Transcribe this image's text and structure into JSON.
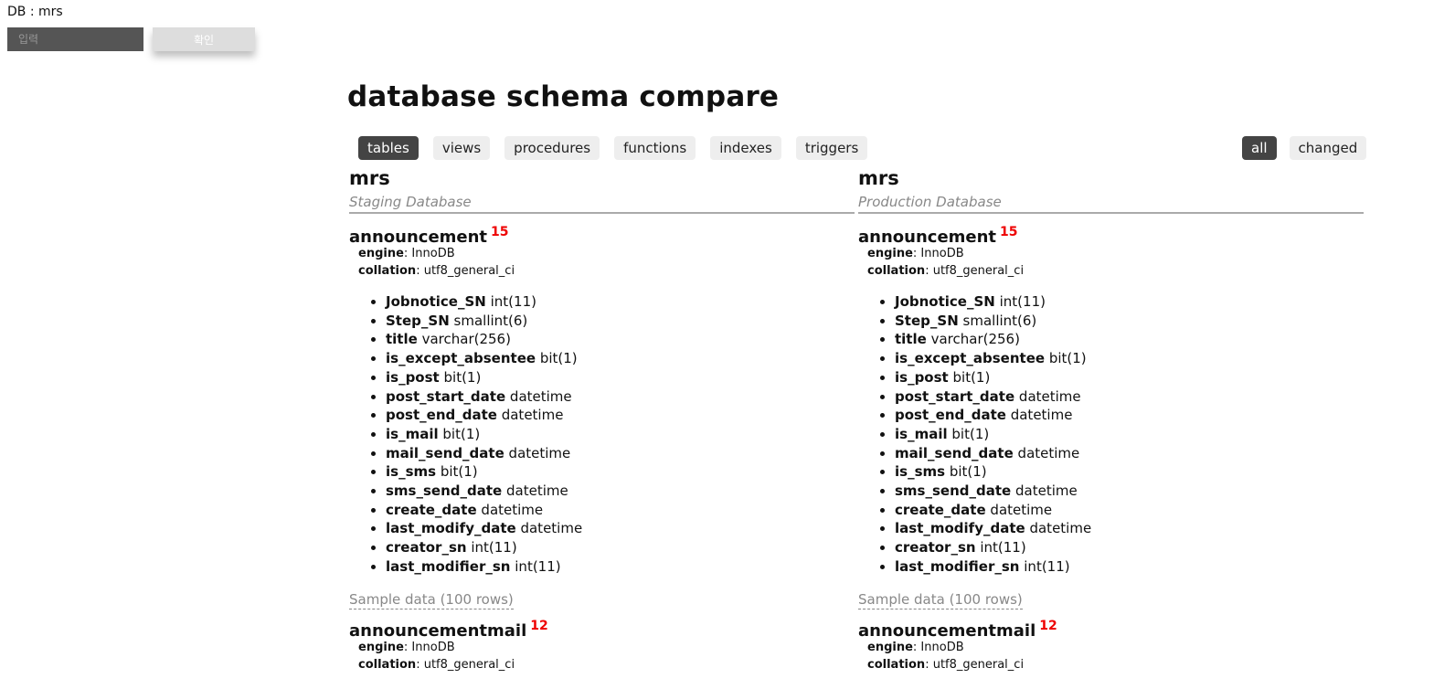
{
  "header": {
    "db_label": "DB : mrs",
    "input_placeholder": "입력",
    "confirm_label": "확인"
  },
  "page_title": "database schema compare",
  "tabs": [
    {
      "label": "tables",
      "active": true
    },
    {
      "label": "views",
      "active": false
    },
    {
      "label": "procedures",
      "active": false
    },
    {
      "label": "functions",
      "active": false
    },
    {
      "label": "indexes",
      "active": false
    },
    {
      "label": "triggers",
      "active": false
    }
  ],
  "filters": [
    {
      "label": "all",
      "active": true
    },
    {
      "label": "changed",
      "active": false
    }
  ],
  "colors": {
    "active_pill": "#444444",
    "pill": "#eeeeee",
    "count": "#ee0000"
  },
  "left": {
    "db_name": "mrs",
    "db_type": "Staging Database",
    "tables": [
      {
        "name": "announcement",
        "count": "15",
        "engine_label": "engine",
        "engine": "InnoDB",
        "collation_label": "collation",
        "collation": "utf8_general_ci",
        "columns": [
          {
            "name": "Jobnotice_SN",
            "type": "int(11)"
          },
          {
            "name": "Step_SN",
            "type": "smallint(6)"
          },
          {
            "name": "title",
            "type": "varchar(256)"
          },
          {
            "name": "is_except_absentee",
            "type": "bit(1)"
          },
          {
            "name": "is_post",
            "type": "bit(1)"
          },
          {
            "name": "post_start_date",
            "type": "datetime"
          },
          {
            "name": "post_end_date",
            "type": "datetime"
          },
          {
            "name": "is_mail",
            "type": "bit(1)"
          },
          {
            "name": "mail_send_date",
            "type": "datetime"
          },
          {
            "name": "is_sms",
            "type": "bit(1)"
          },
          {
            "name": "sms_send_date",
            "type": "datetime"
          },
          {
            "name": "create_date",
            "type": "datetime"
          },
          {
            "name": "last_modify_date",
            "type": "datetime"
          },
          {
            "name": "creator_sn",
            "type": "int(11)"
          },
          {
            "name": "last_modifier_sn",
            "type": "int(11)"
          }
        ],
        "sample_label": "Sample data (100 rows)"
      },
      {
        "name": "announcementmail",
        "count": "12",
        "engine_label": "engine",
        "engine": "InnoDB",
        "collation_label": "collation",
        "collation": "utf8_general_ci"
      }
    ]
  },
  "right": {
    "db_name": "mrs",
    "db_type": "Production Database",
    "tables": [
      {
        "name": "announcement",
        "count": "15",
        "engine_label": "engine",
        "engine": "InnoDB",
        "collation_label": "collation",
        "collation": "utf8_general_ci",
        "columns": [
          {
            "name": "Jobnotice_SN",
            "type": "int(11)"
          },
          {
            "name": "Step_SN",
            "type": "smallint(6)"
          },
          {
            "name": "title",
            "type": "varchar(256)"
          },
          {
            "name": "is_except_absentee",
            "type": "bit(1)"
          },
          {
            "name": "is_post",
            "type": "bit(1)"
          },
          {
            "name": "post_start_date",
            "type": "datetime"
          },
          {
            "name": "post_end_date",
            "type": "datetime"
          },
          {
            "name": "is_mail",
            "type": "bit(1)"
          },
          {
            "name": "mail_send_date",
            "type": "datetime"
          },
          {
            "name": "is_sms",
            "type": "bit(1)"
          },
          {
            "name": "sms_send_date",
            "type": "datetime"
          },
          {
            "name": "create_date",
            "type": "datetime"
          },
          {
            "name": "last_modify_date",
            "type": "datetime"
          },
          {
            "name": "creator_sn",
            "type": "int(11)"
          },
          {
            "name": "last_modifier_sn",
            "type": "int(11)"
          }
        ],
        "sample_label": "Sample data (100 rows)"
      },
      {
        "name": "announcementmail",
        "count": "12",
        "engine_label": "engine",
        "engine": "InnoDB",
        "collation_label": "collation",
        "collation": "utf8_general_ci"
      }
    ]
  }
}
